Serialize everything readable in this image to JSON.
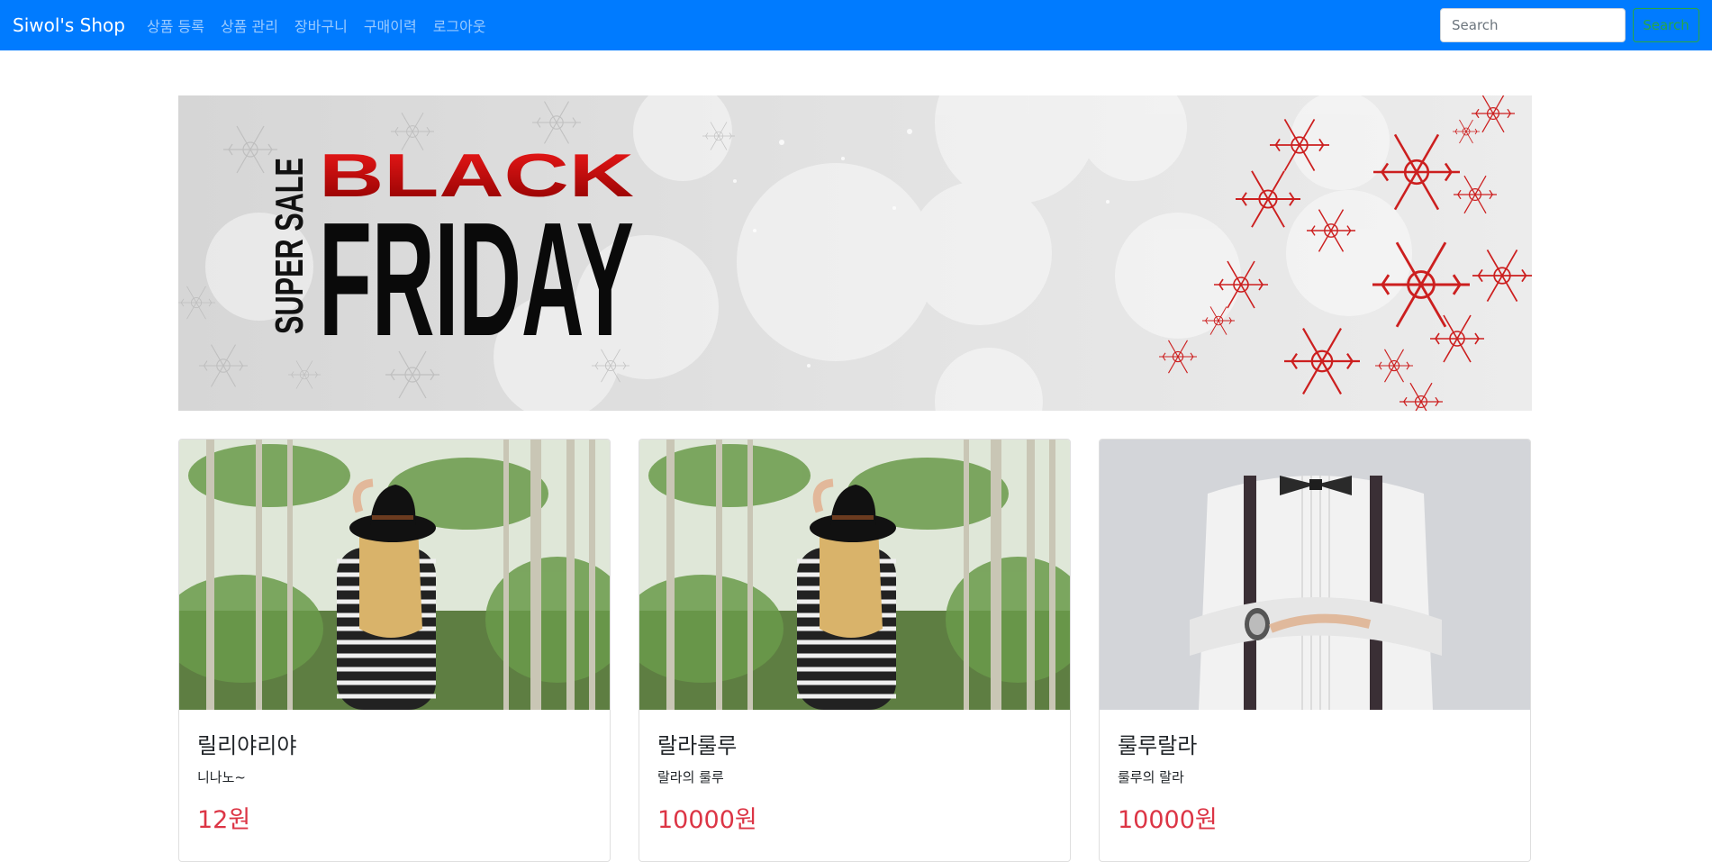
{
  "navbar": {
    "brand": "Siwol's Shop",
    "links": [
      "상품 등록",
      "상품 관리",
      "장바구니",
      "구매이력",
      "로그아웃"
    ],
    "search": {
      "placeholder": "Search",
      "button_label": "Search"
    },
    "colors": {
      "background": "#007bff",
      "search_button": "#28a745"
    }
  },
  "banner": {
    "line1": "SUPER SALE",
    "line2": "BLACK",
    "line3": "FRIDAY"
  },
  "products": [
    {
      "title": "릴리야리야",
      "description": "니나노~",
      "price": "12원",
      "image": "woman-in-forest"
    },
    {
      "title": "랄라룰루",
      "description": "랄라의 룰루",
      "price": "10000원",
      "image": "woman-in-forest"
    },
    {
      "title": "룰루랄라",
      "description": "룰루의 랄라",
      "price": "10000원",
      "image": "man-with-bowtie"
    }
  ],
  "colors": {
    "price": "#dc3545"
  }
}
